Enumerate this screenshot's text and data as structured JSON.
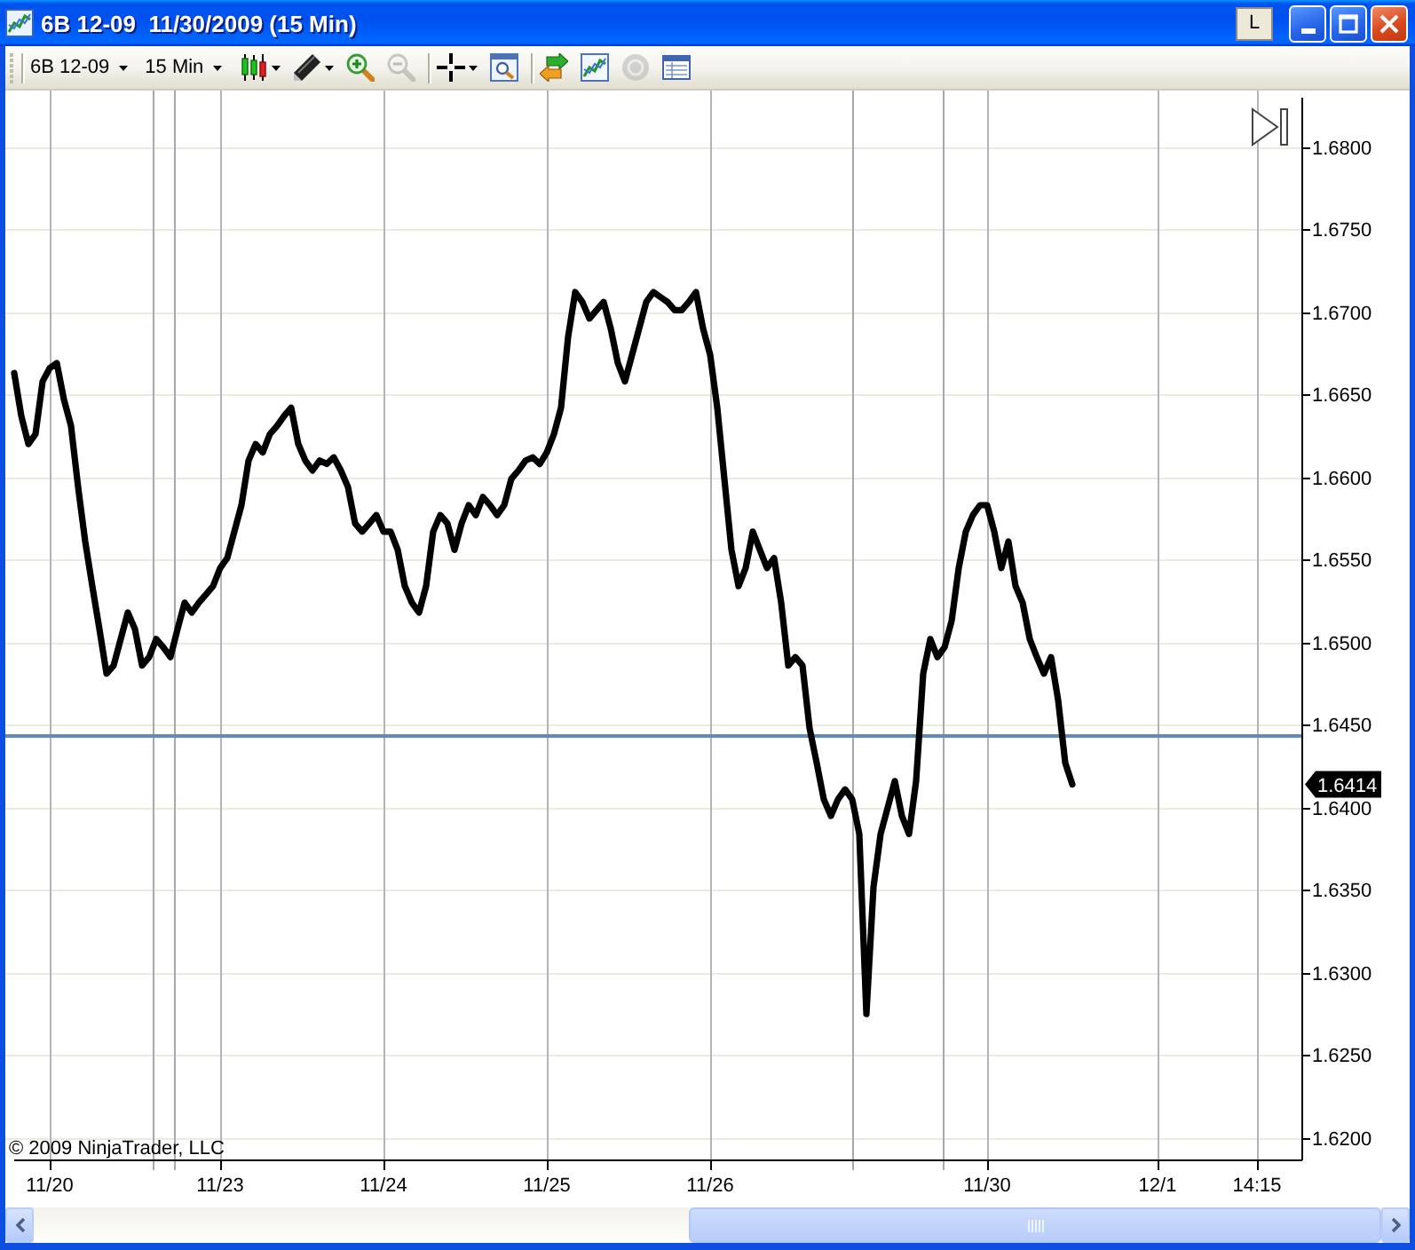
{
  "window": {
    "title": "6B 12-09  11/30/2009 (15 Min)",
    "title_button": "L"
  },
  "toolbar": {
    "items": [
      {
        "kind": "separator"
      },
      {
        "kind": "dropdown",
        "label": "6B 12-09"
      },
      {
        "kind": "dropdown",
        "label": "15 Min"
      },
      {
        "kind": "candles",
        "dropdown": true,
        "disabled": false
      },
      {
        "kind": "pencil",
        "dropdown": true,
        "disabled": false
      },
      {
        "kind": "zoom-in",
        "dropdown": false,
        "disabled": false
      },
      {
        "kind": "zoom-out",
        "dropdown": false,
        "disabled": true
      },
      {
        "kind": "separator"
      },
      {
        "kind": "crosshair",
        "dropdown": true,
        "disabled": false
      },
      {
        "kind": "zoom-box",
        "dropdown": false,
        "disabled": false
      },
      {
        "kind": "separator"
      },
      {
        "kind": "arrows",
        "dropdown": false,
        "disabled": false
      },
      {
        "kind": "chart",
        "dropdown": false,
        "disabled": false
      },
      {
        "kind": "circle",
        "dropdown": false,
        "disabled": true
      },
      {
        "kind": "table",
        "dropdown": false,
        "disabled": false
      }
    ]
  },
  "chart": {
    "copyright": "© 2009 NinjaTrader, LLC",
    "chart_data": {
      "type": "line",
      "grid": true,
      "categories": [
        null,
        null,
        null,
        null,
        null,
        "11/20",
        null,
        null,
        null,
        null,
        null,
        null,
        null,
        null,
        null,
        null,
        null,
        null,
        null,
        null,
        null,
        null,
        null,
        null,
        null,
        null,
        null,
        null,
        null,
        "11/23",
        null,
        null,
        null,
        null,
        null,
        null,
        null,
        null,
        null,
        null,
        null,
        null,
        null,
        null,
        null,
        null,
        null,
        null,
        null,
        null,
        null,
        null,
        "11/24",
        null,
        null,
        null,
        null,
        null,
        null,
        null,
        null,
        null,
        null,
        null,
        null,
        null,
        null,
        null,
        null,
        null,
        null,
        null,
        null,
        null,
        null,
        "11/25",
        null,
        null,
        null,
        null,
        null,
        null,
        null,
        null,
        null,
        null,
        null,
        null,
        null,
        null,
        null,
        null,
        null,
        null,
        null,
        null,
        null,
        null,
        "11/26",
        null,
        null,
        null,
        null,
        null,
        null,
        null,
        null,
        null,
        null,
        null,
        null,
        null,
        null,
        null,
        null,
        null,
        null,
        null,
        null,
        null,
        null,
        null,
        null,
        null,
        null,
        null,
        null,
        null,
        null,
        null,
        null,
        null,
        null,
        null,
        null,
        null,
        null,
        "11/30",
        null,
        null,
        null,
        null,
        null,
        null,
        null,
        null,
        null,
        null,
        null,
        null,
        null,
        null,
        null,
        null,
        null,
        null,
        null,
        null,
        null,
        null,
        null,
        "12/1",
        null,
        null,
        null,
        null,
        null,
        null,
        null,
        null,
        null,
        null,
        null,
        null,
        null,
        "14:15",
        null,
        null,
        null,
        null,
        null
      ],
      "series": [
        {
          "color": "#000000",
          "values": [
            1.6663,
            1.6637,
            1.662,
            1.6626,
            1.6658,
            1.6666,
            1.6669,
            1.6647,
            1.6631,
            1.6594,
            1.6561,
            1.6534,
            1.6508,
            1.6481,
            1.6486,
            1.6502,
            1.6518,
            1.6508,
            1.6486,
            1.6491,
            1.6502,
            1.6497,
            1.6491,
            1.6508,
            1.6524,
            1.6518,
            1.6524,
            1.6529,
            1.6534,
            1.6545,
            1.6551,
            1.6567,
            1.6583,
            1.661,
            1.662,
            1.6615,
            1.6626,
            1.6631,
            1.6637,
            1.6642,
            1.662,
            1.661,
            1.6604,
            1.661,
            1.6608,
            1.6612,
            1.6604,
            1.6594,
            1.6572,
            1.6567,
            1.6572,
            1.6577,
            1.6567,
            1.6567,
            1.6556,
            1.6534,
            1.6524,
            1.6518,
            1.6534,
            1.6567,
            1.6577,
            1.6572,
            1.6556,
            1.6572,
            1.6583,
            1.6577,
            1.6588,
            1.6583,
            1.6577,
            1.6583,
            1.6599,
            1.6604,
            1.661,
            1.6612,
            1.6608,
            1.6615,
            1.6626,
            1.6642,
            1.6685,
            1.6712,
            1.6706,
            1.6696,
            1.6701,
            1.6706,
            1.669,
            1.6669,
            1.6658,
            1.6674,
            1.669,
            1.6706,
            1.6712,
            1.6709,
            1.6706,
            1.6701,
            1.6701,
            1.6706,
            1.6712,
            1.669,
            1.6674,
            1.6642,
            1.6599,
            1.6556,
            1.6534,
            1.6545,
            1.6567,
            1.6556,
            1.6545,
            1.6551,
            1.6524,
            1.6486,
            1.6491,
            1.6486,
            1.6448,
            1.6427,
            1.6405,
            1.6395,
            1.6405,
            1.6411,
            1.6405,
            1.6384,
            1.6275,
            1.6352,
            1.6384,
            1.64,
            1.6416,
            1.6395,
            1.6384,
            1.6416,
            1.6481,
            1.6502,
            1.6491,
            1.6497,
            1.6513,
            1.6545,
            1.6567,
            1.6577,
            1.6583,
            1.6583,
            1.6567,
            1.6545,
            1.6561,
            1.6534,
            1.6524,
            1.6502,
            1.6491,
            1.6481,
            1.6491,
            1.6465,
            1.6427,
            1.6414,
            null,
            null,
            null,
            null,
            null,
            null,
            null,
            null,
            null,
            null,
            null,
            null,
            null,
            null,
            null,
            null,
            null,
            null,
            null,
            null,
            null,
            null,
            null,
            null,
            null,
            null,
            null,
            null,
            null,
            null,
            null
          ]
        }
      ],
      "ylim": [
        1.6187,
        1.6834
      ],
      "yticks": [
        {
          "value": 1.62,
          "label": "1.6200"
        },
        {
          "value": 1.625,
          "label": "1.6250"
        },
        {
          "value": 1.63,
          "label": "1.6300"
        },
        {
          "value": 1.635,
          "label": "1.6350"
        },
        {
          "value": 1.64,
          "label": "1.6400"
        },
        {
          "value": 1.645,
          "label": "1.6450"
        },
        {
          "value": 1.65,
          "label": "1.6500"
        },
        {
          "value": 1.655,
          "label": "1.6550"
        },
        {
          "value": 1.66,
          "label": "1.6600"
        },
        {
          "value": 1.665,
          "label": "1.6650"
        },
        {
          "value": 1.67,
          "label": "1.6700"
        },
        {
          "value": 1.675,
          "label": "1.6750"
        },
        {
          "value": 1.68,
          "label": "1.6800"
        }
      ],
      "ref_lines": [
        {
          "axis": "y",
          "value": 1.6444
        }
      ],
      "annotations": [
        "1.6414"
      ]
    }
  }
}
